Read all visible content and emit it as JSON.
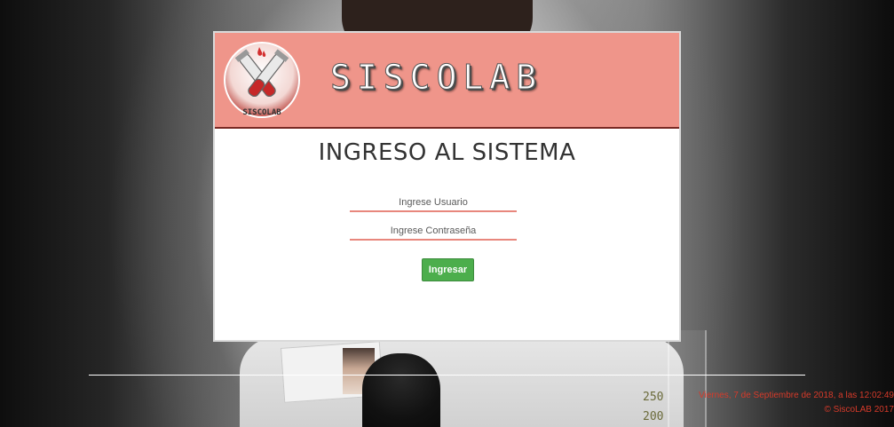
{
  "header": {
    "brand_name": "SISCOLAB",
    "logo_text": "SISCOLAB"
  },
  "login": {
    "title": "INGRESO AL SISTEMA",
    "username_placeholder": "Ingrese Usuario",
    "username_value": "",
    "password_placeholder": "Ingrese Contraseña",
    "password_value": "",
    "submit_label": "Ingresar"
  },
  "footer": {
    "datetime": "Viernes, 7 de Septiembre de 2018, a las 12:02:49",
    "copyright": "© SiscoLAB 2017"
  },
  "background": {
    "beaker_mark_top": "250",
    "beaker_mark_bottom": "200"
  },
  "colors": {
    "header_bg": "#ef958a",
    "header_border": "#7a2a24",
    "field_underline": "#e8877d",
    "submit_bg": "#4cae4c",
    "footer_text": "#d63a2a"
  },
  "icons": {
    "logo": "test-tubes-logo-icon"
  }
}
